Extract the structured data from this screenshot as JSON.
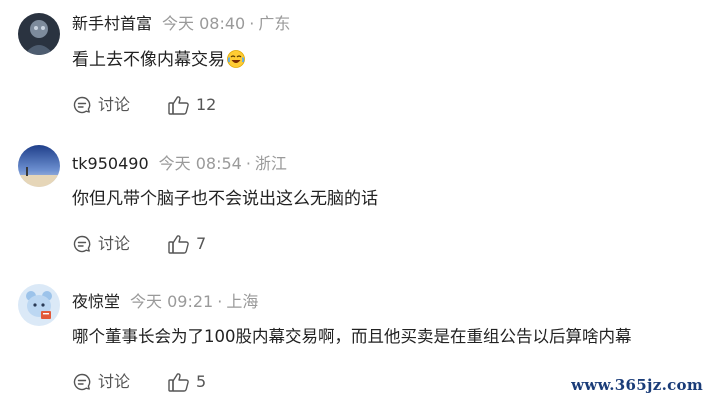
{
  "comments": [
    {
      "username": "新手村首富",
      "time": "今天 08:40",
      "location": "广东",
      "text": "看上去不像内幕交易",
      "emoji": "crying-laughing-emoji",
      "discuss_label": "讨论",
      "likes": "12"
    },
    {
      "username": "tk950490",
      "time": "今天 08:54",
      "location": "浙江",
      "text": "你但凡带个脑子也不会说出这么无脑的话",
      "discuss_label": "讨论",
      "likes": "7"
    },
    {
      "username": "夜惊堂",
      "time": "今天 09:21",
      "location": "上海",
      "text": "哪个董事长会为了100股内幕交易啊，而且他买卖是在重组公告以后算啥内幕",
      "discuss_label": "讨论",
      "likes": "5"
    }
  ],
  "separator": "·",
  "watermark": "www.365jz.com",
  "colors": {
    "text": "#222222",
    "meta": "#9a9a9a",
    "action": "#555555",
    "watermark": "#1a3c78"
  }
}
